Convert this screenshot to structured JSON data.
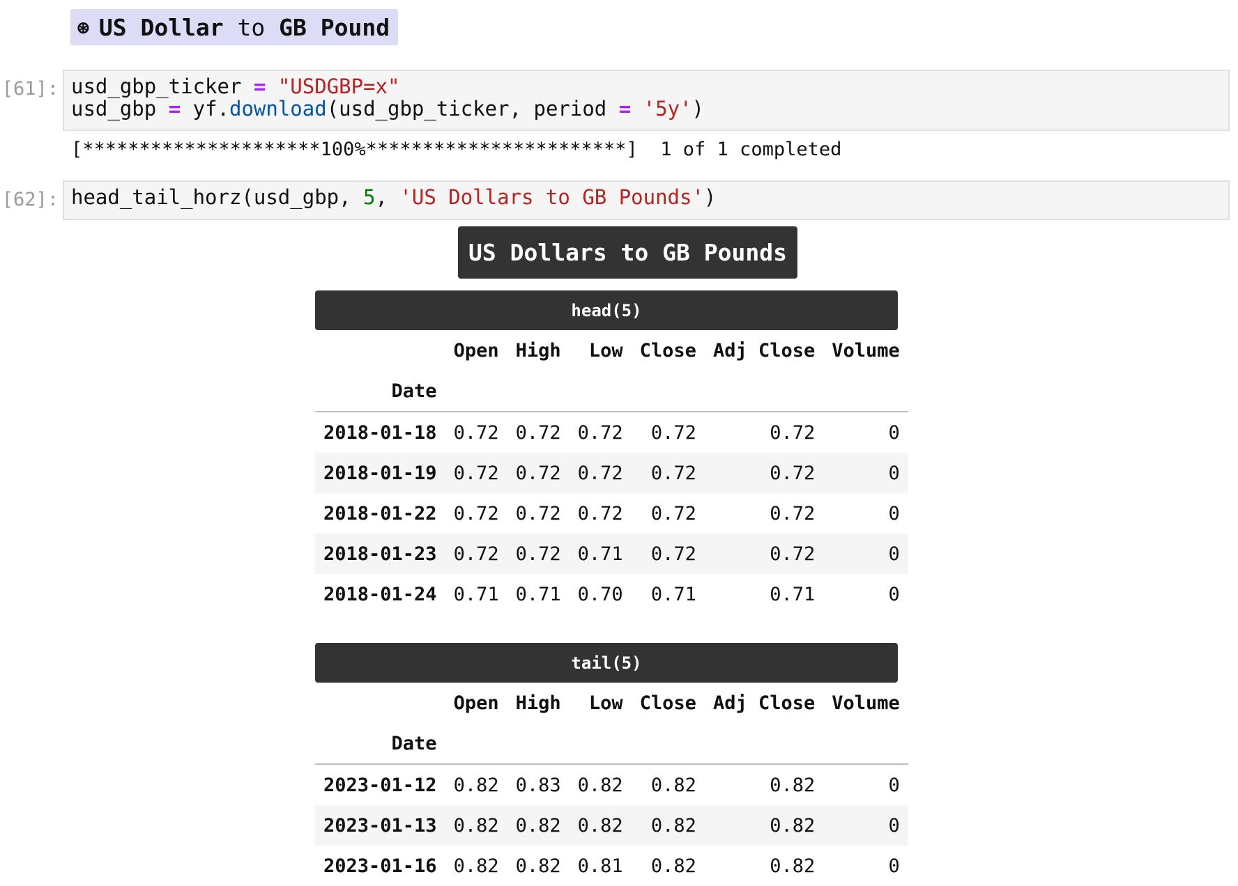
{
  "markdown_heading": {
    "bullet": "⊛",
    "text_before": "US Dollar",
    "text_mid": "to",
    "text_after": "GB Pound"
  },
  "cells": [
    {
      "prompt": "[61]:",
      "lines": [
        [
          {
            "t": "usd_gbp_ticker ",
            "c": ""
          },
          {
            "t": "=",
            "c": "op"
          },
          {
            "t": " ",
            "c": ""
          },
          {
            "t": "\"USDGBP=x\"",
            "c": "str"
          }
        ],
        [
          {
            "t": "usd_gbp ",
            "c": ""
          },
          {
            "t": "=",
            "c": "op"
          },
          {
            "t": " yf.",
            "c": ""
          },
          {
            "t": "download",
            "c": "fn"
          },
          {
            "t": "(usd_gbp_ticker, period ",
            "c": ""
          },
          {
            "t": "=",
            "c": "op"
          },
          {
            "t": " ",
            "c": ""
          },
          {
            "t": "'5y'",
            "c": "str"
          },
          {
            "t": ")",
            "c": ""
          }
        ]
      ]
    },
    {
      "prompt": "[62]:",
      "lines": [
        [
          {
            "t": "head_tail_horz(usd_gbp, ",
            "c": ""
          },
          {
            "t": "5",
            "c": "num"
          },
          {
            "t": ", ",
            "c": ""
          },
          {
            "t": "'US Dollars to GB Pounds'",
            "c": "str"
          },
          {
            "t": ")",
            "c": ""
          }
        ]
      ]
    }
  ],
  "progress_output": "[*********************100%***********************]  1 of 1 completed",
  "output_title": "US Dollars to GB Pounds",
  "columns": [
    "Open",
    "High",
    "Low",
    "Close",
    "Adj Close",
    "Volume"
  ],
  "index_name": "Date",
  "head": {
    "label": "head(5)",
    "rows": [
      {
        "date": "2018-01-18",
        "values": [
          "0.72",
          "0.72",
          "0.72",
          "0.72",
          "0.72",
          "0"
        ]
      },
      {
        "date": "2018-01-19",
        "values": [
          "0.72",
          "0.72",
          "0.72",
          "0.72",
          "0.72",
          "0"
        ]
      },
      {
        "date": "2018-01-22",
        "values": [
          "0.72",
          "0.72",
          "0.72",
          "0.72",
          "0.72",
          "0"
        ]
      },
      {
        "date": "2018-01-23",
        "values": [
          "0.72",
          "0.72",
          "0.71",
          "0.72",
          "0.72",
          "0"
        ]
      },
      {
        "date": "2018-01-24",
        "values": [
          "0.71",
          "0.71",
          "0.70",
          "0.71",
          "0.71",
          "0"
        ]
      }
    ]
  },
  "tail": {
    "label": "tail(5)",
    "rows": [
      {
        "date": "2023-01-12",
        "values": [
          "0.82",
          "0.83",
          "0.82",
          "0.82",
          "0.82",
          "0"
        ]
      },
      {
        "date": "2023-01-13",
        "values": [
          "0.82",
          "0.82",
          "0.82",
          "0.82",
          "0.82",
          "0"
        ]
      },
      {
        "date": "2023-01-16",
        "values": [
          "0.82",
          "0.82",
          "0.81",
          "0.82",
          "0.82",
          "0"
        ]
      }
    ]
  }
}
